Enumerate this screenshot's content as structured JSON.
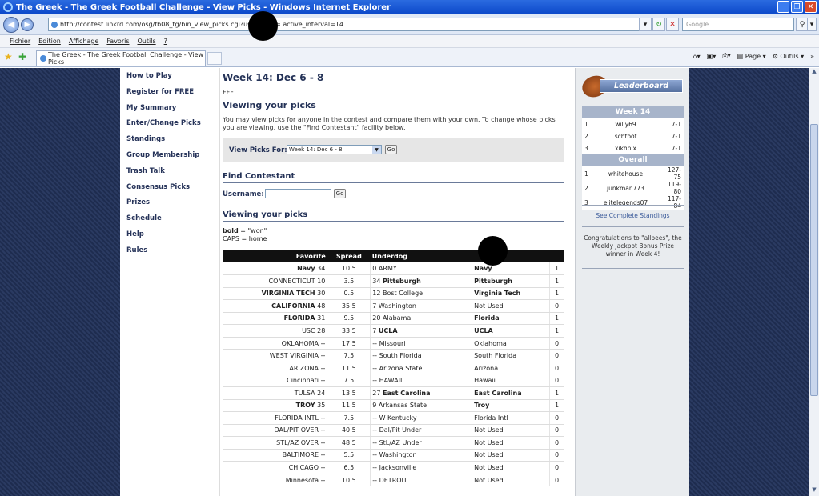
{
  "window": {
    "title": "The Greek - The Greek Football Challenge - View Picks - Windows Internet Explorer"
  },
  "address": {
    "url": "http://contest.linkrd.com/osg/fb08_tg/bin_view_picks.cgi?username=                    active_interval=14",
    "search_placeholder": "Google"
  },
  "menu": [
    "Fichier",
    "Edition",
    "Affichage",
    "Favoris",
    "Outils",
    "?"
  ],
  "tab": {
    "label": "The Greek - The Greek Football Challenge - View Picks"
  },
  "tab_tools": {
    "page": "Page",
    "tools": "Outils"
  },
  "nav": [
    "How to Play",
    "Register for FREE",
    "My Summary",
    "Enter/Change Picks",
    "Standings",
    "Group Membership",
    "Trash Talk",
    "Consensus Picks",
    "Prizes",
    "Schedule",
    "Help",
    "Rules"
  ],
  "main": {
    "title": "Week 14: Dec 6 - 8",
    "user": "FFF",
    "viewing_heading": "Viewing your picks",
    "description": "You may view picks for anyone in the contest and compare them with your own. To change whose picks you are viewing, use the \"Find Contestant\" facility below.",
    "view_picks_label": "View Picks For:",
    "week_select": "Week 14: Dec 6 - 8",
    "go": "Go",
    "find_heading": "Find Contestant",
    "username_label": "Username:",
    "picks_heading": "Viewing your picks",
    "legend_bold": "bold = \"won\"",
    "legend_caps": "CAPS = home"
  },
  "table": {
    "headers": {
      "favorite": "Favorite",
      "spread": "Spread",
      "underdog": "Underdog",
      "pick": ""
    },
    "rows": [
      {
        "fav": "Navy",
        "favScore": "34",
        "favBold": true,
        "spread": "10.5",
        "undScore": "0",
        "und": "ARMY",
        "undBold": false,
        "pick": "Navy",
        "pickBold": true,
        "pts": "1"
      },
      {
        "fav": "CONNECTICUT",
        "favScore": "10",
        "favBold": false,
        "spread": "3.5",
        "undScore": "34",
        "und": "Pittsburgh",
        "undBold": true,
        "pick": "Pittsburgh",
        "pickBold": true,
        "pts": "1"
      },
      {
        "fav": "VIRGINIA TECH",
        "favScore": "30",
        "favBold": true,
        "spread": "0.5",
        "undScore": "12",
        "und": "Bost College",
        "undBold": false,
        "pick": "Virginia Tech",
        "pickBold": true,
        "pts": "1"
      },
      {
        "fav": "CALIFORNIA",
        "favScore": "48",
        "favBold": true,
        "spread": "35.5",
        "undScore": "7",
        "und": "Washington",
        "undBold": false,
        "pick": "Not Used",
        "pickBold": false,
        "pts": "0"
      },
      {
        "fav": "FLORIDA",
        "favScore": "31",
        "favBold": true,
        "spread": "9.5",
        "undScore": "20",
        "und": "Alabama",
        "undBold": false,
        "pick": "Florida",
        "pickBold": true,
        "pts": "1"
      },
      {
        "fav": "USC",
        "favScore": "28",
        "favBold": false,
        "spread": "33.5",
        "undScore": "7",
        "und": "UCLA",
        "undBold": true,
        "pick": "UCLA",
        "pickBold": true,
        "pts": "1"
      },
      {
        "fav": "OKLAHOMA",
        "favScore": "--",
        "favBold": false,
        "spread": "17.5",
        "undScore": "--",
        "und": "Missouri",
        "undBold": false,
        "pick": "Oklahoma",
        "pickBold": false,
        "pts": "0"
      },
      {
        "fav": "WEST VIRGINIA",
        "favScore": "--",
        "favBold": false,
        "spread": "7.5",
        "undScore": "--",
        "und": "South Florida",
        "undBold": false,
        "pick": "South Florida",
        "pickBold": false,
        "pts": "0"
      },
      {
        "fav": "ARIZONA",
        "favScore": "--",
        "favBold": false,
        "spread": "11.5",
        "undScore": "--",
        "und": "Arizona State",
        "undBold": false,
        "pick": "Arizona",
        "pickBold": false,
        "pts": "0"
      },
      {
        "fav": "Cincinnati",
        "favScore": "--",
        "favBold": false,
        "spread": "7.5",
        "undScore": "--",
        "und": "HAWAII",
        "undBold": false,
        "pick": "Hawaii",
        "pickBold": false,
        "pts": "0"
      },
      {
        "fav": "TULSA",
        "favScore": "24",
        "favBold": false,
        "spread": "13.5",
        "undScore": "27",
        "und": "East Carolina",
        "undBold": true,
        "pick": "East Carolina",
        "pickBold": true,
        "pts": "1"
      },
      {
        "fav": "TROY",
        "favScore": "35",
        "favBold": true,
        "spread": "11.5",
        "undScore": "9",
        "und": "Arkansas State",
        "undBold": false,
        "pick": "Troy",
        "pickBold": true,
        "pts": "1"
      },
      {
        "fav": "FLORIDA INTL",
        "favScore": "--",
        "favBold": false,
        "spread": "7.5",
        "undScore": "--",
        "und": "W Kentucky",
        "undBold": false,
        "pick": "Florida Intl",
        "pickBold": false,
        "pts": "0"
      },
      {
        "fav": "DAL/PIT OVER",
        "favScore": "--",
        "favBold": false,
        "spread": "40.5",
        "undScore": "--",
        "und": "Dal/Pit Under",
        "undBold": false,
        "pick": "Not Used",
        "pickBold": false,
        "pts": "0"
      },
      {
        "fav": "STL/AZ OVER",
        "favScore": "--",
        "favBold": false,
        "spread": "48.5",
        "undScore": "--",
        "und": "StL/AZ Under",
        "undBold": false,
        "pick": "Not Used",
        "pickBold": false,
        "pts": "0"
      },
      {
        "fav": "BALTIMORE",
        "favScore": "--",
        "favBold": false,
        "spread": "5.5",
        "undScore": "--",
        "und": "Washington",
        "undBold": false,
        "pick": "Not Used",
        "pickBold": false,
        "pts": "0"
      },
      {
        "fav": "CHICAGO",
        "favScore": "--",
        "favBold": false,
        "spread": "6.5",
        "undScore": "--",
        "und": "Jacksonville",
        "undBold": false,
        "pick": "Not Used",
        "pickBold": false,
        "pts": "0"
      },
      {
        "fav": "Minnesota",
        "favScore": "--",
        "favBold": false,
        "spread": "10.5",
        "undScore": "--",
        "und": "DETROIT",
        "undBold": false,
        "pick": "Not Used",
        "pickBold": false,
        "pts": "0"
      }
    ]
  },
  "leaderboard": {
    "logo_text": "Leaderboard",
    "week_heading": "Week 14",
    "week": [
      {
        "rank": "1",
        "name": "willy69",
        "record": "7-1"
      },
      {
        "rank": "2",
        "name": "schtoof",
        "record": "7-1"
      },
      {
        "rank": "3",
        "name": "xikhpix",
        "record": "7-1"
      }
    ],
    "overall_heading": "Overall",
    "overall": [
      {
        "rank": "1",
        "name": "whitehouse",
        "record": "127-75"
      },
      {
        "rank": "2",
        "name": "junkman773",
        "record": "119-80"
      },
      {
        "rank": "3",
        "name": "elitelegends07",
        "record": "117-84"
      }
    ],
    "see_all": "See Complete Standings",
    "congrats": "Congratulations to \"allbees\", the Weekly Jackpot Bonus Prize winner in Week 4!"
  }
}
